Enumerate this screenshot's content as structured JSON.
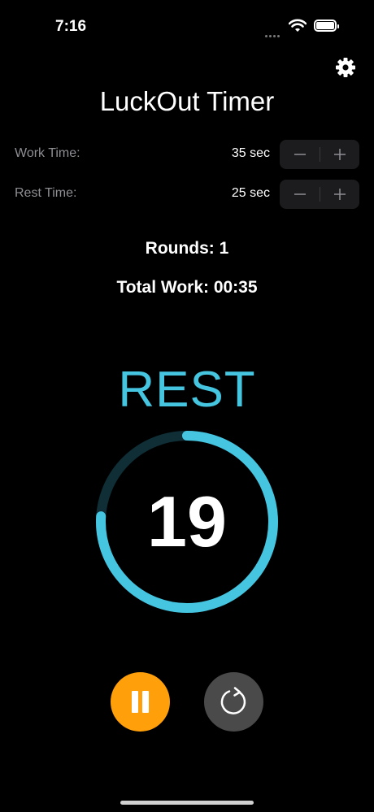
{
  "status_bar": {
    "time": "7:16",
    "icons": [
      "signal-dots-icon",
      "wifi-icon",
      "battery-icon"
    ]
  },
  "app": {
    "title": "LuckOut Timer",
    "settings_icon": "gear-icon"
  },
  "settings": {
    "work": {
      "label": "Work Time:",
      "value": "35 sec",
      "minus_icon": "minus-icon",
      "plus_icon": "plus-icon"
    },
    "rest": {
      "label": "Rest Time:",
      "value": "25 sec",
      "minus_icon": "minus-icon",
      "plus_icon": "plus-icon"
    }
  },
  "summary": {
    "rounds": "Rounds: 1",
    "total_work": "Total Work: 00:35"
  },
  "timer": {
    "phase": "REST",
    "seconds_remaining": "19",
    "progress_fraction": 0.76,
    "accent_color": "#45c5e0",
    "track_color": "#0f2e36"
  },
  "controls": {
    "pause_icon": "pause-icon",
    "pause_color": "#ff9f0a",
    "reset_icon": "reset-icon",
    "reset_color": "#4a4a4a"
  }
}
